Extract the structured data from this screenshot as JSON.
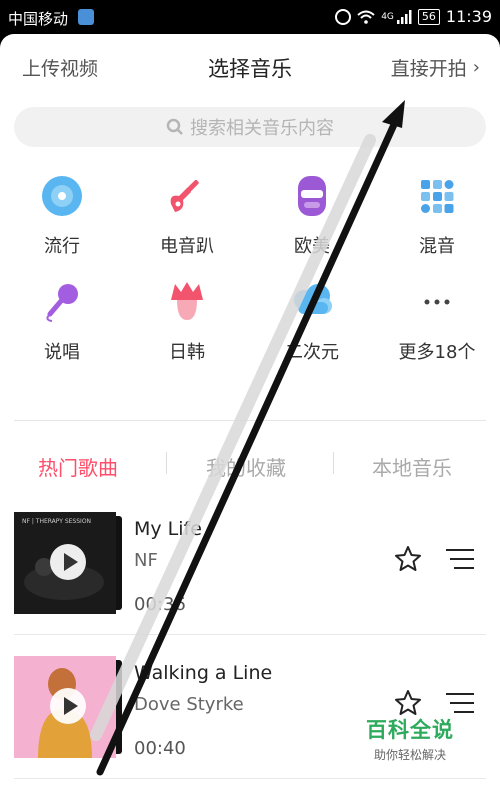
{
  "status_bar": {
    "carrier": "中国移动",
    "network": "4G",
    "battery": "56",
    "time": "11:39"
  },
  "header": {
    "left_label": "上传视频",
    "title": "选择音乐",
    "right_label": "直接开拍"
  },
  "search": {
    "placeholder": "搜索相关音乐内容"
  },
  "genres": [
    {
      "label": "流行",
      "icon": "disc-icon"
    },
    {
      "label": "电音趴",
      "icon": "electric-guitar-icon"
    },
    {
      "label": "欧美",
      "icon": "face-with-sunglasses-icon"
    },
    {
      "label": "混音",
      "icon": "grid-dots-icon"
    },
    {
      "label": "说唱",
      "icon": "microphone-icon"
    },
    {
      "label": "日韩",
      "icon": "anime-head-icon"
    },
    {
      "label": "二次元",
      "icon": "cloud-character-icon"
    },
    {
      "label": "更多18个",
      "icon": "more-dots-icon"
    }
  ],
  "tabs": [
    {
      "label": "热门歌曲",
      "active": true
    },
    {
      "label": "我的收藏",
      "active": false
    },
    {
      "label": "本地音乐",
      "active": false
    }
  ],
  "songs": [
    {
      "title": "My Life",
      "artist": "NF",
      "duration": "00:36",
      "cover_text": "NF | THERAPY SESSION"
    },
    {
      "title": "Walking a Line",
      "artist": "Dove Styrke",
      "duration": "00:40"
    }
  ],
  "watermark": {
    "title": "百科全说",
    "subtitle": "助你轻松解决"
  },
  "colors": {
    "accent": "#ff4d6a",
    "watermark_green": "#2eaa5c"
  }
}
